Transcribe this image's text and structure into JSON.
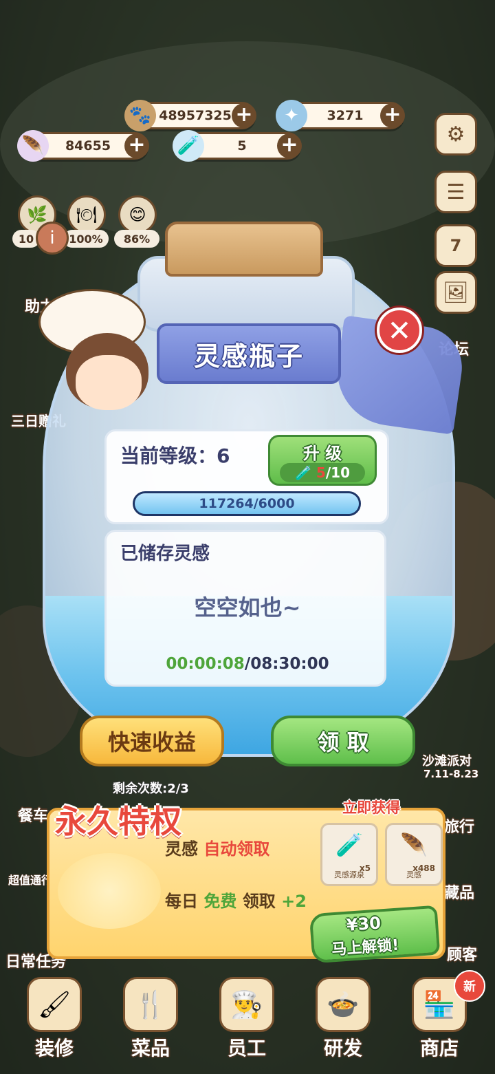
{
  "currency": {
    "coins": "48957325",
    "stars": "3271",
    "inspiration": "84655",
    "bottles": "5"
  },
  "stats": {
    "stat1": "10",
    "stat2": "100%",
    "stat3": "86%"
  },
  "left_side": {
    "assist": "助力",
    "three_day_gift": "三日赠礼",
    "cafeteria": "餐车",
    "value_pass": "超值通行",
    "daily_tasks": "日常任务"
  },
  "right_side": {
    "calendar_day": "7",
    "forum": "论坛",
    "beach_party": "沙滩派对",
    "beach_party_dates": "7.11-8.23",
    "travel": "旅行",
    "collection": "藏品",
    "guest": "顾客"
  },
  "dialog": {
    "title": "灵感瓶子",
    "level_label": "当前等级：6",
    "upgrade_label": "升 级",
    "upgrade_have": "5",
    "upgrade_need": "/10",
    "progress_text": "117264/6000",
    "progress_fraction": 1.0,
    "stored_title": "已储存灵感",
    "empty_text": "空空如也~",
    "timer_elapsed": "00:00:08",
    "timer_total": "/08:30:00",
    "quick_button": "快速收益",
    "claim_button": "领 取",
    "remaining": "剩余次数:2/3"
  },
  "privilege": {
    "title": "永久特权",
    "line1_prefix": "灵感 ",
    "line1_highlight": "自动领取",
    "line2_prefix": "每日 ",
    "line2_free": "免费",
    "line2_mid": " 领取 ",
    "line2_bonus": "+2",
    "get_now": "立即获得",
    "reward1_qty": "x5",
    "reward1_name": "灵感源泉",
    "reward2_qty": "x488",
    "reward2_name": "灵感",
    "price": "¥30",
    "unlock": "马上解锁!"
  },
  "bottom_nav": {
    "decor": "装修",
    "dishes": "菜品",
    "staff": "员工",
    "research": "研发",
    "shop": "商店",
    "new_badge": "新"
  },
  "colors": {
    "accent_red": "#e8483c",
    "accent_green": "#5fbf4b",
    "accent_yellow": "#f7b83c",
    "ribbon_blue": "#6a7ccf"
  }
}
